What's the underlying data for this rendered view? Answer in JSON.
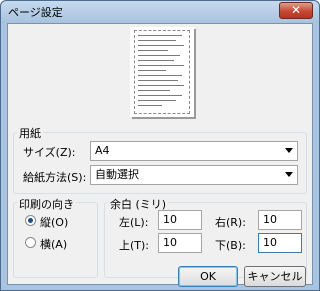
{
  "window": {
    "title": "ページ設定",
    "close_glyph": "✕"
  },
  "paper": {
    "group_label": "用紙",
    "size_label": "サイズ(Z):",
    "size_value": "A4",
    "source_label": "給紙方法(S):",
    "source_value": "自動選択"
  },
  "orientation": {
    "group_label": "印刷の向き",
    "portrait_label": "縦(O)",
    "landscape_label": "横(A)",
    "selected": "portrait"
  },
  "margins": {
    "group_label": "余白 (ミリ)",
    "left_label": "左(L):",
    "left_value": "10",
    "right_label": "右(R):",
    "right_value": "10",
    "top_label": "上(T):",
    "top_value": "10",
    "bottom_label": "下(B):",
    "bottom_value": "10"
  },
  "buttons": {
    "ok": "OK",
    "cancel": "キャンセル"
  },
  "colors": {
    "titlebar": "#a8c2de",
    "client": "#f0f0f0",
    "close": "#c44a36"
  }
}
